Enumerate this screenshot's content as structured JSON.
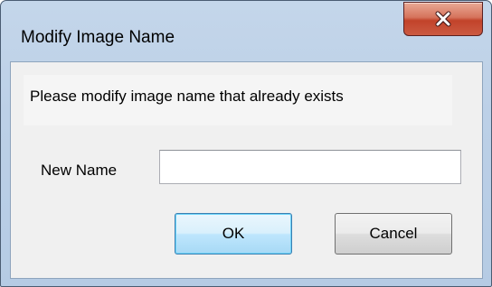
{
  "window": {
    "title": "Modify Image Name",
    "close_icon": "close-icon"
  },
  "dialog": {
    "message": "Please modify image name that already exists",
    "name_label": "New Name",
    "name_value": "",
    "ok_label": "OK",
    "cancel_label": "Cancel"
  },
  "colors": {
    "close_button": "#c8472e",
    "ok_button_border": "#3c7fb1",
    "client_background": "#f0f0f0"
  }
}
